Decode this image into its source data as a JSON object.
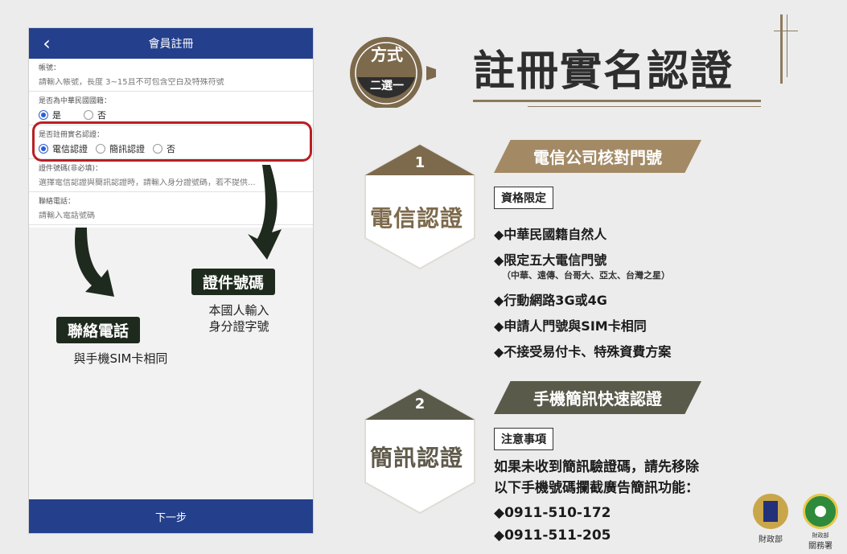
{
  "phone": {
    "title": "會員註冊",
    "account_label": "帳號：",
    "account_placeholder": "請輸入帳號，長度 3~15且不可包含空白及特殊符號",
    "nationality_label": "是否為中華民國國籍：",
    "nationality_yes": "是",
    "nationality_no": "否",
    "verify_label": "是否註冊實名認證：",
    "verify_options": [
      "電信認證",
      "簡訊認證",
      "否"
    ],
    "id_label": "證件號碼(非必填)：",
    "id_placeholder": "選擇電信認證與簡訊認證時，請輸入身分證號碼，若不提供...",
    "phone_label": "聯絡電話：",
    "phone_placeholder": "請輸入電話號碼",
    "next_button": "下一步"
  },
  "callouts": {
    "id_tag": "證件號碼",
    "id_desc_line1": "本國人輸入",
    "id_desc_line2": "身分證字號",
    "phone_tag": "聯絡電話",
    "phone_desc": "與手機SIM卡相同"
  },
  "header": {
    "badge_top": "方式",
    "badge_bottom": "二選一",
    "title": "註冊實名認證"
  },
  "method1": {
    "number": "1",
    "name": "電信認證",
    "banner": "電信公司核對門號",
    "box_label": "資格限定",
    "bullets": [
      "◆中華民國籍自然人",
      "◆限定五大電信門號",
      "◆行動網路3G或4G",
      "◆申請人門號與SIM卡相同",
      "◆不接受易付卡、特殊資費方案"
    ],
    "sub_note": "（中華、遠傳、台哥大、亞太、台灣之星）"
  },
  "method2": {
    "number": "2",
    "name": "簡訊認證",
    "banner": "手機簡訊快速認證",
    "box_label": "注意事項",
    "notice_line1": "如果未收到簡訊驗證碼，請先移除",
    "notice_line2": "以下手機號碼攔截廣告簡訊功能：",
    "numbers": [
      "◆0911-510-172",
      "◆0911-511-205"
    ]
  },
  "logos": {
    "mof": "財政部",
    "customs_small": "財政部",
    "customs": "關務署"
  },
  "colors": {
    "brand_blue": "#243f8c",
    "accent_brown": "#8c7a5e",
    "highlight_red": "#b81f24",
    "dark_green": "#1e2a1d"
  }
}
